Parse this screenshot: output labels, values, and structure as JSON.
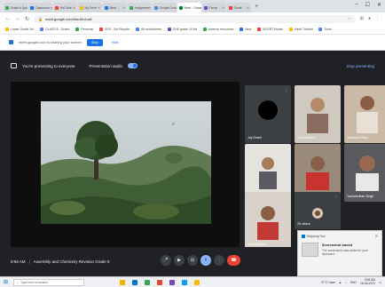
{
  "browser": {
    "tabs": [
      {
        "label": "Grade 6 Quiz",
        "color": "#34a853"
      },
      {
        "label": "Classroom",
        "color": "#1a73e8"
      },
      {
        "label": "YouTube",
        "color": "#ea4335"
      },
      {
        "label": "My Drive",
        "color": "#fbbc04"
      },
      {
        "label": "Meet",
        "color": "#1a73e8"
      },
      {
        "label": "Assignment",
        "color": "#34a853"
      },
      {
        "label": "Google Docs",
        "color": "#4285f4"
      },
      {
        "label": "Meet - Grade 8",
        "color": "#00832d",
        "active": true
      },
      {
        "label": "Forms",
        "color": "#7248b9"
      },
      {
        "label": "Gmail",
        "color": "#ea4335"
      }
    ],
    "new_tab": "+",
    "window_controls": [
      "–",
      "☐",
      "✕"
    ],
    "url": "meet.google.com/hiw-fkrd-sdf",
    "bookmarks": [
      {
        "label": "Lower Grade Sci",
        "color": "#fbbc04"
      },
      {
        "label": "CLASS 8 - Grade",
        "color": "#4285f4"
      },
      {
        "label": "Personal",
        "color": "#34a853"
      },
      {
        "label": "APS - Sci Physics",
        "color": "#ea4335"
      },
      {
        "label": "All worksheets",
        "color": "#4285f4"
      },
      {
        "label": "CHS grade 10 list",
        "color": "#7248b9"
      },
      {
        "label": "science resources",
        "color": "#34a853"
      },
      {
        "label": "New",
        "color": "#1a73e8"
      },
      {
        "label": "NCERT Books",
        "color": "#ea4335"
      },
      {
        "label": "Hindi Tutorial",
        "color": "#fbbc04"
      },
      {
        "label": "Tools",
        "color": "#4285f4"
      }
    ]
  },
  "infobar": {
    "text": "meet.google.com is sharing your screen",
    "share_label": "Stop",
    "hide_label": "Hide"
  },
  "meet": {
    "presenting_label": "You're presenting to everyone",
    "audio_label": "Presentation audio",
    "stop_label": "Stop presenting",
    "time": "9:58 AM",
    "separator": "|",
    "meeting_name": "Assembly and Chemistry Revision Grade 8",
    "participants": [
      {
        "name": "Jay Bharti"
      },
      {
        "name": "Aditi Sharma"
      },
      {
        "name": "Vaishnavi Rathi"
      },
      {
        "name": "Ayesha Kumari"
      },
      {
        "name": "Lakshit K. M."
      },
      {
        "name": "Yashvardhan Singh"
      },
      {
        "name": "Jay Waghela"
      },
      {
        "name": "25 others"
      }
    ],
    "controls": [
      "🎤",
      "▶",
      "⊟",
      "⇧",
      "⋮",
      "☎"
    ]
  },
  "toast": {
    "app": "Snipping Tool",
    "title": "Screenshot saved",
    "message": "The screenshot was added to your clipboard."
  },
  "taskbar": {
    "search_placeholder": "Type here to search",
    "apps": [
      "#f4b400",
      "#0078d4",
      "#34a853",
      "#ea4335",
      "#7248b9",
      "#00a4ef",
      "#fbbc04"
    ],
    "weather": "27°C Haze",
    "language": "ENG",
    "time": "9:58 AM",
    "date": "18-08-2021"
  }
}
